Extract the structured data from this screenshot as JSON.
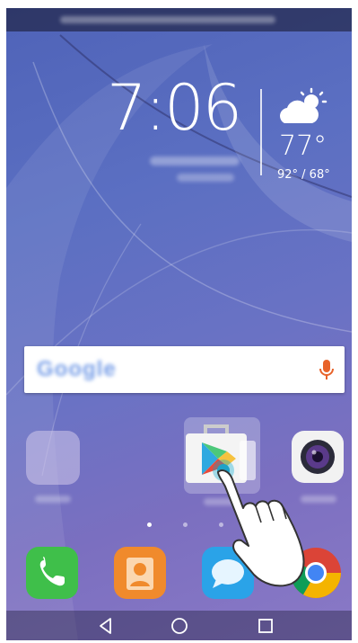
{
  "status_bar": {
    "text_blurred": true
  },
  "clock": {
    "time": "7:06"
  },
  "weather": {
    "icon": "partly-cloudy-sun-icon",
    "temperature": "77°",
    "range": "92° / 68°"
  },
  "search": {
    "logo_text": "Google",
    "mic_icon": "microphone-icon"
  },
  "home_apps": [
    {
      "name": "folder",
      "icon": "folder-icon"
    },
    {
      "name": "play-store",
      "icon": "play-store-icon"
    },
    {
      "name": "camera",
      "icon": "camera-icon"
    }
  ],
  "dock": [
    {
      "name": "phone",
      "icon": "phone-icon",
      "color": "#3fbf4a"
    },
    {
      "name": "contacts",
      "icon": "contacts-icon",
      "color": "#f08a2c"
    },
    {
      "name": "messages",
      "icon": "messages-icon",
      "color": "#2aa3e8"
    },
    {
      "name": "chrome",
      "icon": "chrome-icon"
    }
  ],
  "page_indicator": {
    "pages": 3,
    "current": 1
  },
  "nav_bar": [
    {
      "name": "back",
      "icon": "back-triangle-icon"
    },
    {
      "name": "home",
      "icon": "home-circle-icon"
    },
    {
      "name": "recents",
      "icon": "recents-square-icon"
    }
  ],
  "gesture": {
    "icon": "hand-pointer-icon"
  }
}
